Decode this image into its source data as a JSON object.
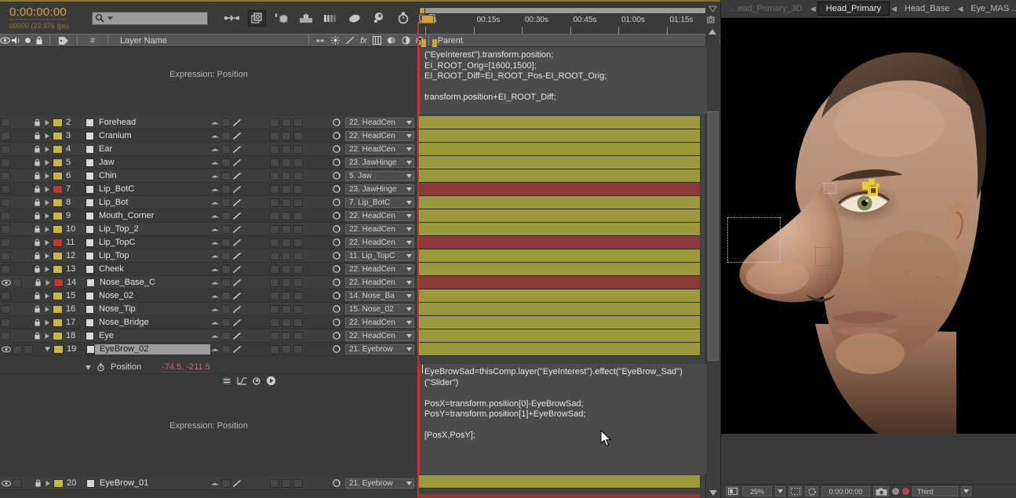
{
  "timeline": {
    "timecode_main": "0:00:00:00",
    "timecode_sub": "00000 (23.976 fps)",
    "search_placeholder": "",
    "search_value": "",
    "columns": {
      "layer_name": "Layer Name",
      "number": "#",
      "parent": "Parent"
    },
    "expression_note_top": "Expression: Position",
    "expression_note_bottom": "Expression: Position",
    "ruler_labels": [
      "0s",
      "00:15s",
      "00:30s",
      "00:45s",
      "01:00s",
      "01:15s"
    ],
    "layers": [
      {
        "num": "2",
        "name": "Forehead",
        "color": "#c9b840",
        "parent": "22. HeadCen",
        "bar": "olive",
        "visible": false,
        "locked": true,
        "expanded": false,
        "selected": false
      },
      {
        "num": "3",
        "name": "Cranium",
        "color": "#c9b840",
        "parent": "22. HeadCen",
        "bar": "olive",
        "visible": false,
        "locked": true,
        "expanded": false,
        "selected": false
      },
      {
        "num": "4",
        "name": "Ear",
        "color": "#c9b840",
        "parent": "22. HeadCen",
        "bar": "olive",
        "visible": false,
        "locked": true,
        "expanded": false,
        "selected": false
      },
      {
        "num": "5",
        "name": "Jaw",
        "color": "#c9b840",
        "parent": "23. JawHinge",
        "bar": "olive",
        "visible": false,
        "locked": true,
        "expanded": false,
        "selected": false
      },
      {
        "num": "6",
        "name": "Chin",
        "color": "#c9b840",
        "parent": "5. Jaw",
        "bar": "olive",
        "visible": false,
        "locked": true,
        "expanded": false,
        "selected": false
      },
      {
        "num": "7",
        "name": "Lip_BotC",
        "color": "#b83a32",
        "parent": "23. JawHinge",
        "bar": "red",
        "visible": false,
        "locked": true,
        "expanded": false,
        "selected": false
      },
      {
        "num": "8",
        "name": "Lip_Bot",
        "color": "#c9b840",
        "parent": "7. Lip_BotC",
        "bar": "olive",
        "visible": false,
        "locked": true,
        "expanded": false,
        "selected": false
      },
      {
        "num": "9",
        "name": "Mouth_Corner",
        "color": "#c9b840",
        "parent": "22. HeadCen",
        "bar": "olive",
        "visible": false,
        "locked": true,
        "expanded": false,
        "selected": false
      },
      {
        "num": "10",
        "name": "Lip_Top_2",
        "color": "#c9b840",
        "parent": "22. HeadCen",
        "bar": "olive",
        "visible": false,
        "locked": true,
        "expanded": false,
        "selected": false
      },
      {
        "num": "11",
        "name": "Lip_TopC",
        "color": "#b83a32",
        "parent": "22. HeadCen",
        "bar": "red",
        "visible": false,
        "locked": true,
        "expanded": false,
        "selected": false
      },
      {
        "num": "12",
        "name": "Lip_Top",
        "color": "#c9b840",
        "parent": "11. Lip_TopC",
        "bar": "olive",
        "visible": false,
        "locked": true,
        "expanded": false,
        "selected": false
      },
      {
        "num": "13",
        "name": "Cheek",
        "color": "#c9b840",
        "parent": "22. HeadCen",
        "bar": "olive",
        "visible": false,
        "locked": true,
        "expanded": false,
        "selected": false
      },
      {
        "num": "14",
        "name": "Nose_Base_C",
        "color": "#b83a32",
        "parent": "22. HeadCen",
        "bar": "red",
        "visible": true,
        "locked": true,
        "expanded": false,
        "selected": false
      },
      {
        "num": "15",
        "name": "Nose_02",
        "color": "#c9b840",
        "parent": "14. Nose_Ba",
        "bar": "olive",
        "visible": false,
        "locked": true,
        "expanded": false,
        "selected": false
      },
      {
        "num": "16",
        "name": "Nose_Tip",
        "color": "#c9b840",
        "parent": "15. Nose_02",
        "bar": "olive",
        "visible": false,
        "locked": true,
        "expanded": false,
        "selected": false
      },
      {
        "num": "17",
        "name": "Nose_Bridge",
        "color": "#c9b840",
        "parent": "22. HeadCen",
        "bar": "olive",
        "visible": false,
        "locked": true,
        "expanded": false,
        "selected": false
      },
      {
        "num": "18",
        "name": "Eye",
        "color": "#c9b840",
        "parent": "22. HeadCen",
        "bar": "olive",
        "visible": false,
        "locked": true,
        "expanded": false,
        "selected": false
      },
      {
        "num": "19",
        "name": "EyeBrow_02",
        "color": "#c9b840",
        "parent": "21. Eyebrow",
        "bar": "olive",
        "visible": true,
        "locked": false,
        "expanded": true,
        "selected": true
      }
    ],
    "property": {
      "label": "Position",
      "value": "-74.5, -211.5"
    },
    "bottom_layer": {
      "num": "20",
      "name": "EyeBrow_01",
      "color": "#c9b840",
      "parent": "21. Eyebrow",
      "bar": "olive",
      "visible": true,
      "locked": true,
      "expanded": false
    },
    "expression_top": "(\"EyeInterest\").transform.position;\nEI_ROOT_Orig=[1600,1500];\nEI_ROOT_Diff=EI_ROOT_Pos-EI_ROOT_Orig;\n\ntransform.position+EI_ROOT_Diff;",
    "expression_bottom": "EyeBrowSad=thisComp.layer(\"EyeInterest\").effect(\"EyeBrow_Sad\")\n(\"Slider\")\n\nPosX=transform.position[0]-EyeBrowSad;\nPosY=transform.position[1]+EyeBrowSad;\n\n[PosX,PosY];"
  },
  "comp": {
    "tabs": [
      {
        "label": "...ead_Primary_3D",
        "active": false,
        "dim": true
      },
      {
        "label": "Head_Primary",
        "active": true,
        "dim": false
      },
      {
        "label": "Head_Base",
        "active": false,
        "dim": false
      },
      {
        "label": "Eye_MAS ...",
        "active": false,
        "dim": false
      }
    ],
    "bottom": {
      "zoom": "25%",
      "timecode": "0:00:00:00",
      "quality": "Third"
    }
  },
  "colors": {
    "accent_gold": "#d3a53a",
    "cti_red": "#c0392b",
    "bar_olive": "#9a9a3c",
    "bar_red": "#8b3a3a",
    "panel_bg": "#3a3a3a"
  }
}
